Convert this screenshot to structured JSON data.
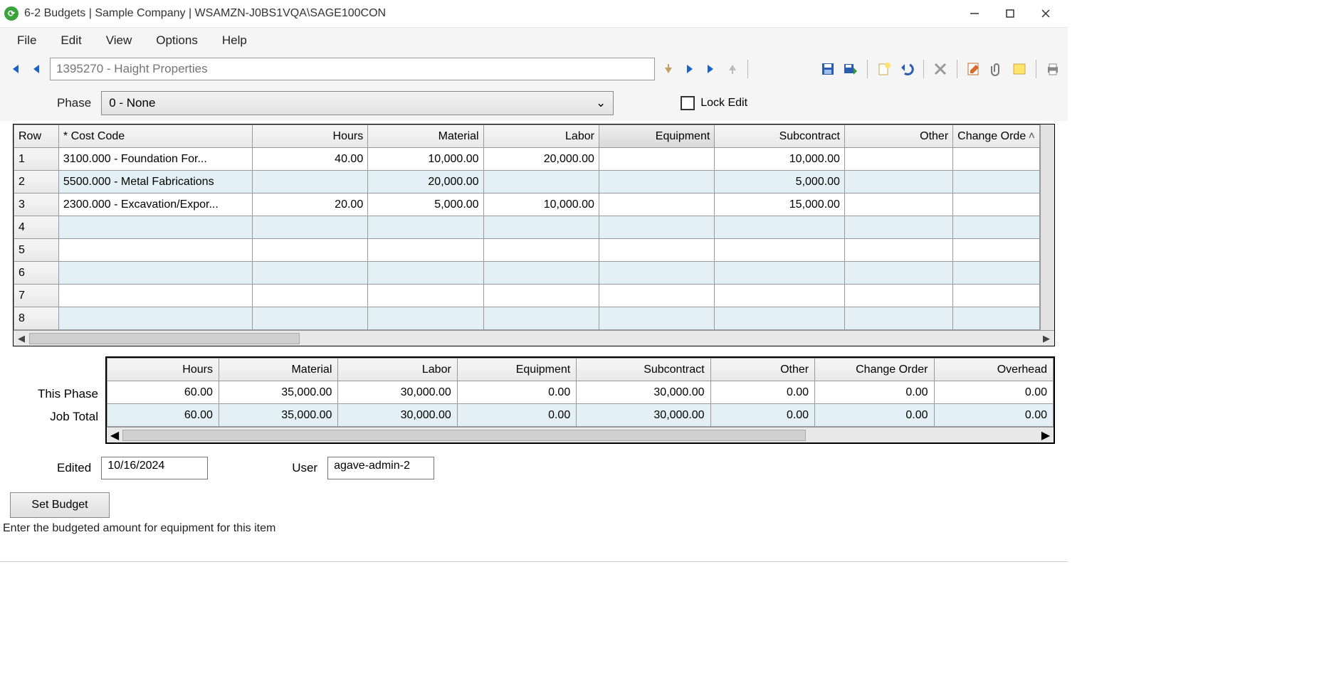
{
  "title": "6-2 Budgets  |  Sample Company  |  WSAMZN-J0BS1VQA\\SAGE100CON",
  "menus": [
    "File",
    "Edit",
    "View",
    "Options",
    "Help"
  ],
  "record_search_placeholder": "1395270 - Haight Properties",
  "phase_label": "Phase",
  "phase_value": "0 - None",
  "lock_edit_label": "Lock Edit",
  "grid": {
    "columns": [
      "Row",
      "* Cost Code",
      "Hours",
      "Material",
      "Labor",
      "Equipment",
      "Subcontract",
      "Other",
      "Change Orde"
    ],
    "scroll_up_glyph": "˄",
    "rows": [
      {
        "n": "1",
        "cost": "3100.000 - Foundation For...",
        "hours": "40.00",
        "material": "10,000.00",
        "labor": "20,000.00",
        "equipment": "",
        "subcontract": "10,000.00",
        "other": "",
        "change": ""
      },
      {
        "n": "2",
        "cost": "5500.000 - Metal Fabrications",
        "hours": "",
        "material": "20,000.00",
        "labor": "",
        "equipment": "",
        "subcontract": "5,000.00",
        "other": "",
        "change": ""
      },
      {
        "n": "3",
        "cost": "2300.000 - Excavation/Expor...",
        "hours": "20.00",
        "material": "5,000.00",
        "labor": "10,000.00",
        "equipment": "",
        "subcontract": "15,000.00",
        "other": "",
        "change": ""
      },
      {
        "n": "4",
        "cost": "",
        "hours": "",
        "material": "",
        "labor": "",
        "equipment": "",
        "subcontract": "",
        "other": "",
        "change": ""
      },
      {
        "n": "5",
        "cost": "",
        "hours": "",
        "material": "",
        "labor": "",
        "equipment": "",
        "subcontract": "",
        "other": "",
        "change": ""
      },
      {
        "n": "6",
        "cost": "",
        "hours": "",
        "material": "",
        "labor": "",
        "equipment": "",
        "subcontract": "",
        "other": "",
        "change": ""
      },
      {
        "n": "7",
        "cost": "",
        "hours": "",
        "material": "",
        "labor": "",
        "equipment": "",
        "subcontract": "",
        "other": "",
        "change": ""
      },
      {
        "n": "8",
        "cost": "",
        "hours": "",
        "material": "",
        "labor": "",
        "equipment": "",
        "subcontract": "",
        "other": "",
        "change": ""
      }
    ]
  },
  "summary": {
    "row_labels": [
      "This Phase",
      "Job Total"
    ],
    "columns": [
      "Hours",
      "Material",
      "Labor",
      "Equipment",
      "Subcontract",
      "Other",
      "Change Order",
      "Overhead"
    ],
    "phase": [
      "60.00",
      "35,000.00",
      "30,000.00",
      "0.00",
      "30,000.00",
      "0.00",
      "0.00",
      "0.00"
    ],
    "job": [
      "60.00",
      "35,000.00",
      "30,000.00",
      "0.00",
      "30,000.00",
      "0.00",
      "0.00",
      "0.00"
    ]
  },
  "edited_label": "Edited",
  "edited_value": "10/16/2024",
  "user_label": "User",
  "user_value": "agave-admin-2",
  "set_budget_label": "Set Budget",
  "status_text": "Enter the budgeted amount for equipment for this item"
}
